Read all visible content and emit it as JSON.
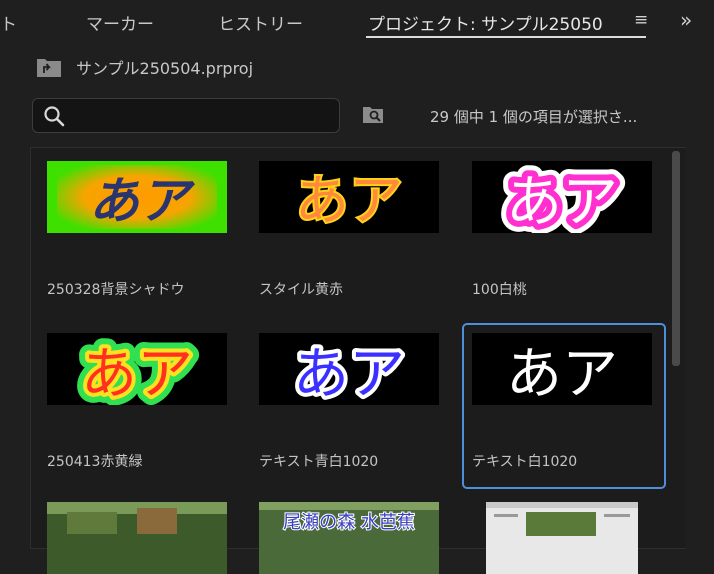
{
  "tabs": [
    {
      "label": "ト"
    },
    {
      "label": "マーカー"
    },
    {
      "label": "ヒストリー"
    },
    {
      "label": "プロジェクト: サンプル25050"
    }
  ],
  "tab_menu_glyph": "≡",
  "tab_overflow_glyph": "»",
  "project": {
    "name": "サンプル250504.prproj"
  },
  "search": {
    "value": "",
    "placeholder": ""
  },
  "selection_status": "29 個中 1 個の項目が選択さ...",
  "clips": [
    {
      "label": "250328背景シャドウ",
      "thumb_text": "あア",
      "selected": false
    },
    {
      "label": "スタイル黄赤",
      "thumb_text": "あア",
      "selected": false
    },
    {
      "label": "100白桃",
      "thumb_text": "あア",
      "selected": false
    },
    {
      "label": "250413赤黄緑",
      "thumb_text": "あア",
      "selected": false
    },
    {
      "label": "テキスト青白1020",
      "thumb_text": "あア",
      "selected": false
    },
    {
      "label": "テキスト白1020",
      "thumb_text": "あア",
      "selected": true
    }
  ],
  "partial_clips": [
    {
      "thumb_text": "尾瀬の森 水芭蕉"
    }
  ],
  "colors": {
    "accent_selection": "#4f8ed8",
    "panel_bg": "#1f1f1f"
  }
}
